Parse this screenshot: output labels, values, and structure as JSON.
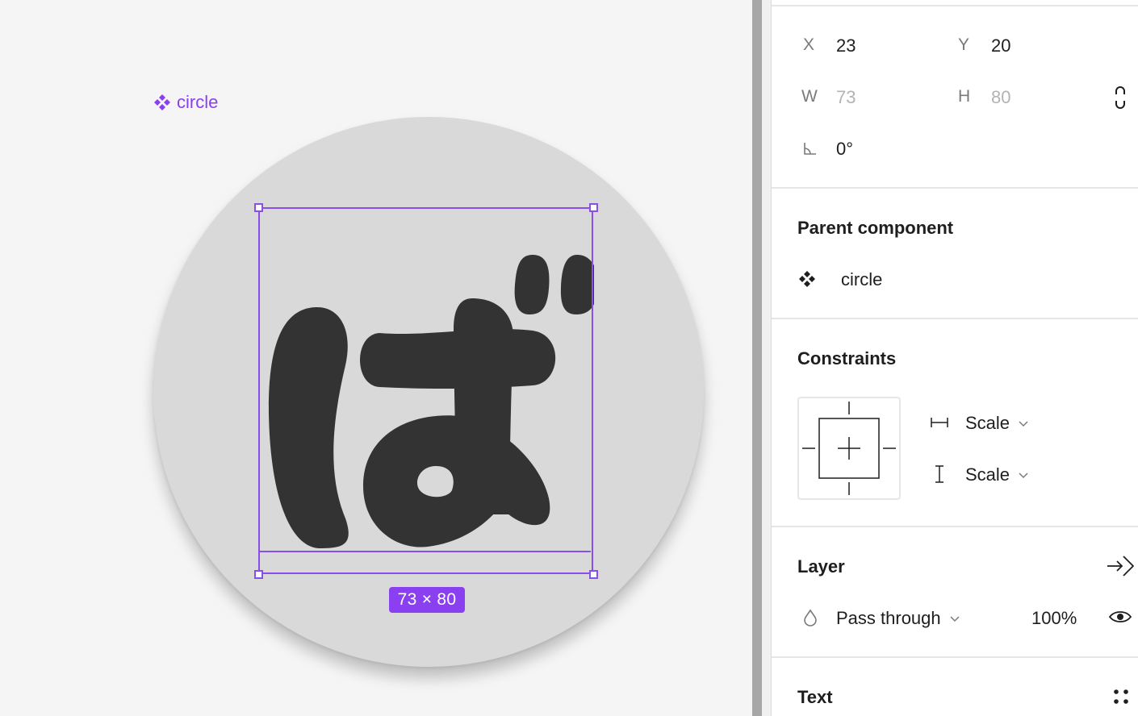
{
  "canvas": {
    "component_label": "circle",
    "glyph_text": "ば",
    "dimension_badge": "73 × 80"
  },
  "panel": {
    "position": {
      "x_label": "X",
      "x_value": "23",
      "y_label": "Y",
      "y_value": "20",
      "w_label": "W",
      "w_value": "73",
      "h_label": "H",
      "h_value": "80",
      "rotation_value": "0°"
    },
    "parent_component": {
      "title": "Parent component",
      "name": "circle"
    },
    "constraints": {
      "title": "Constraints",
      "horizontal": "Scale",
      "vertical": "Scale"
    },
    "layer": {
      "title": "Layer",
      "blend_mode": "Pass through",
      "opacity": "100%"
    },
    "text": {
      "title": "Text"
    }
  },
  "colors": {
    "selection": "#8a4fe8",
    "component_purple": "#8a3ff0",
    "glyph_fill": "#333333",
    "circle_fill": "#d9d9d9"
  }
}
